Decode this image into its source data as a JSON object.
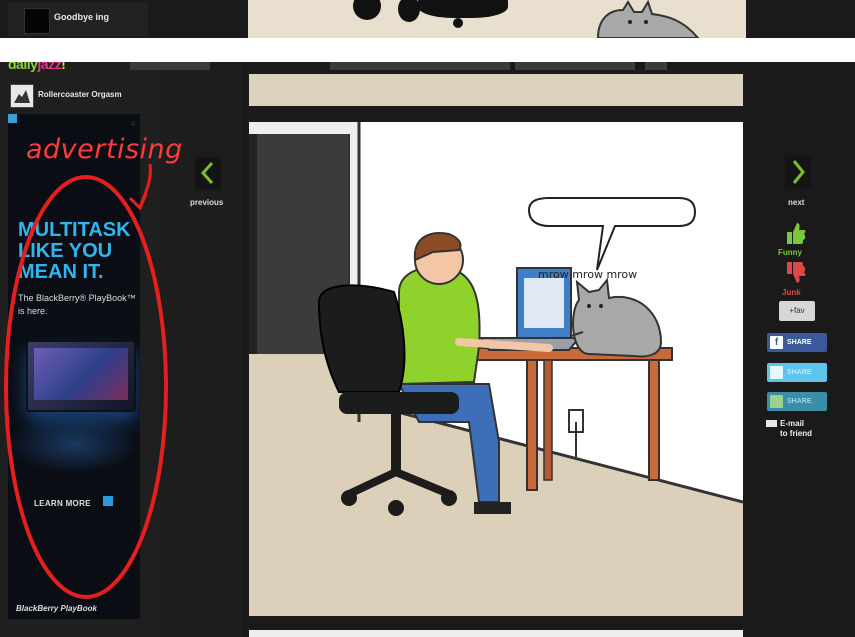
{
  "top_strip": {
    "title": "Goodbye ing"
  },
  "site": {
    "logo_part1": "daily",
    "logo_part2": "jazz",
    "logo_part3": "!"
  },
  "post": {
    "author": "Rollercoaster Orgasm"
  },
  "ad": {
    "headline": [
      "MULTITASK",
      "LIKE YOU",
      "MEAN IT."
    ],
    "subline": "The BlackBerry® PlayBook™ is here.",
    "cta": "LEARN MORE",
    "footer": "BlackBerry PlayBook"
  },
  "annotation": {
    "text": "advertising",
    "color": "#ff2a2a"
  },
  "navigation": {
    "previous": "previous",
    "next": "next"
  },
  "comic": {
    "speech": "mrow mrow mrow"
  },
  "votes": {
    "funny": "Funny",
    "junk": "Junk",
    "fav": "+fav"
  },
  "share": {
    "facebook": "SHARE",
    "twitter": "SHARE",
    "stumbleupon": "SHARE",
    "email": "E-mail",
    "email2": "to friend"
  },
  "colors": {
    "accent_green": "#7cc83b",
    "accent_red": "#e04848",
    "facebook": "#3b5998",
    "twitter": "#5fc3ec"
  }
}
